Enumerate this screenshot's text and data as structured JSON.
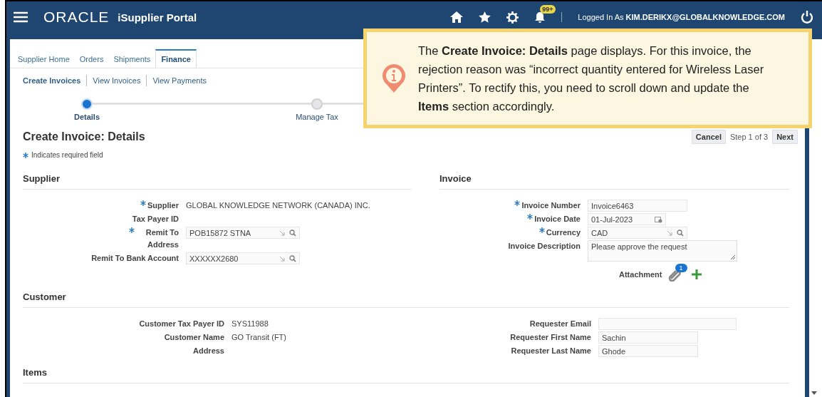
{
  "header": {
    "logo": "ORACLE",
    "app_title": "iSupplier Portal",
    "notification_badge": "99+",
    "logged_in_label": "Logged In As",
    "user": "KIM.DERIKX@GLOBALKNOWLEDGE.COM"
  },
  "tabs": [
    {
      "label": "Supplier Home",
      "selected": false
    },
    {
      "label": "Orders",
      "selected": false
    },
    {
      "label": "Shipments",
      "selected": false
    },
    {
      "label": "Finance",
      "selected": true
    }
  ],
  "subtabs": [
    {
      "label": "Create Invoices",
      "selected": true
    },
    {
      "label": "View Invoices",
      "selected": false
    },
    {
      "label": "View Payments",
      "selected": false
    }
  ],
  "train": [
    {
      "label": "Details",
      "selected": true
    },
    {
      "label": "Manage Tax",
      "selected": false
    }
  ],
  "page_title": "Create Invoice: Details",
  "required_note": "Indicates required field",
  "actions": {
    "cancel": "Cancel",
    "step": "Step 1 of 3",
    "next": "Next"
  },
  "supplier": {
    "title": "Supplier",
    "fields": [
      {
        "kind": "text",
        "label": "Supplier",
        "required": true,
        "value": "GLOBAL KNOWLEDGE NETWORK (CANADA) INC."
      },
      {
        "kind": "text",
        "label": "Tax Payer ID",
        "required": false
      },
      {
        "kind": "lov",
        "label": "Remit To Address",
        "required": true,
        "label_wrapped": true,
        "value": "POB15872 STNA"
      },
      {
        "kind": "lov",
        "label": "Remit To Bank Account",
        "required": false,
        "value": "XXXXXX2680"
      }
    ]
  },
  "invoice": {
    "title": "Invoice",
    "fields": [
      {
        "kind": "input",
        "label": "Invoice Number",
        "required": true,
        "value": "Invoice6463"
      },
      {
        "kind": "date",
        "label": "Invoice Date",
        "required": true,
        "value": "01-Jul-2023"
      },
      {
        "kind": "lov",
        "label": "Currency",
        "required": true,
        "value": "CAD"
      },
      {
        "kind": "textarea",
        "label": "Invoice Description",
        "required": false,
        "value": "Please approve the request"
      },
      {
        "kind": "attachment",
        "label": "Attachment",
        "required": false,
        "value": "1"
      }
    ]
  },
  "customer": {
    "title": "Customer",
    "left_fields": [
      {
        "kind": "text",
        "label": "Customer Tax Payer ID",
        "required": false,
        "value": "SYS11988"
      },
      {
        "kind": "text",
        "label": "Customer Name",
        "required": false,
        "value": "GO Transit (FT)"
      },
      {
        "kind": "text",
        "label": "Address",
        "required": false
      }
    ],
    "right_fields": [
      {
        "kind": "input",
        "label": "Requester Email",
        "required": false,
        "wide": true
      },
      {
        "kind": "input",
        "label": "Requester First Name",
        "required": false,
        "value": "Sachin"
      },
      {
        "kind": "input",
        "label": "Requester Last Name",
        "required": false,
        "value": "Ghode"
      }
    ]
  },
  "items": {
    "title": "Items"
  },
  "callout": {
    "text": "The **Create Invoice: Details** page displays. For this invoice, the rejection reason was “incorrect quantity entered for Wireless Laser Printers”. To rectify this, you need to scroll down and update the **Items** section accordingly."
  }
}
